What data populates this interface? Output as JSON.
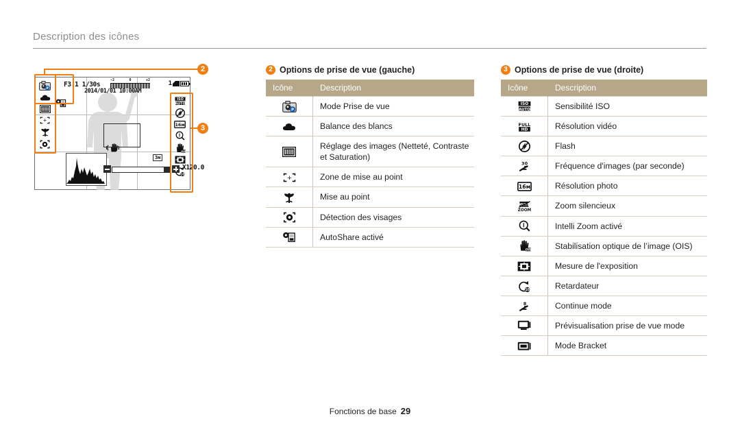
{
  "page": {
    "title": "Description des icônes",
    "footer_label": "Fonctions de base",
    "footer_page": "29"
  },
  "lcd": {
    "aperture_shutter": "F3.1 1/30s",
    "date": "2014/01/01",
    "time": "10:00AM",
    "ev_min": "-2",
    "ev_zero": "0",
    "ev_max": "+2",
    "shots_remaining": "1",
    "zoom_factor": "X120.0",
    "video_res_badge": "3м",
    "left_icons": [
      "shooting-mode-icon",
      "white-balance-icon",
      "image-adjust-icon",
      "focus-area-icon",
      "macro-focus-icon",
      "face-detection-icon"
    ],
    "autoshare_icon": "autoshare-icon",
    "right_icons": [
      "iso-icon",
      "flash-icon",
      "photo-resolution-icon",
      "intelli-zoom-icon",
      "ois-icon",
      "metering-icon",
      "timer-icon"
    ],
    "callout_badges": [
      "2",
      "3"
    ]
  },
  "sections": [
    {
      "badge": "2",
      "title": "Options de prise de vue (gauche)",
      "columns": [
        "Icône",
        "Description"
      ],
      "rows": [
        {
          "icon": "shooting-mode-icon",
          "label": "Mode Prise de vue"
        },
        {
          "icon": "white-balance-icon",
          "label": "Balance des blancs"
        },
        {
          "icon": "image-adjust-icon",
          "label": "Réglage des images (Netteté, Contraste et Saturation)"
        },
        {
          "icon": "focus-area-icon",
          "label": "Zone de mise au point"
        },
        {
          "icon": "macro-focus-icon",
          "label": "Mise au point"
        },
        {
          "icon": "face-detection-icon",
          "label": "Détection des visages"
        },
        {
          "icon": "autoshare-icon",
          "label": "AutoShare activé"
        }
      ]
    },
    {
      "badge": "3",
      "title": "Options de prise de vue (droite)",
      "columns": [
        "Icône",
        "Description"
      ],
      "rows": [
        {
          "icon": "iso-icon",
          "label": "Sensibilité ISO"
        },
        {
          "icon": "video-resolution-icon",
          "label": "Résolution vidéo"
        },
        {
          "icon": "flash-icon",
          "label": "Flash"
        },
        {
          "icon": "frame-rate-icon",
          "label": "Fréquence d'images (par seconde)"
        },
        {
          "icon": "photo-resolution-icon",
          "label": "Résolution photo"
        },
        {
          "icon": "silent-zoom-icon",
          "label": "Zoom silencieux"
        },
        {
          "icon": "intelli-zoom-icon",
          "label": "Intelli Zoom activé"
        },
        {
          "icon": "ois-icon",
          "label": "Stabilisation optique de l’image (OIS)"
        },
        {
          "icon": "metering-icon",
          "label": "Mesure de l'exposition"
        },
        {
          "icon": "timer-icon",
          "label": "Retardateur"
        },
        {
          "icon": "continuous-icon",
          "label": "Continue mode"
        },
        {
          "icon": "shot-preview-icon",
          "label": "Prévisualisation prise de vue mode"
        },
        {
          "icon": "bracket-icon",
          "label": "Mode Bracket"
        }
      ]
    }
  ],
  "colors": {
    "accent_orange": "#f07f13",
    "table_header": "#b5a788",
    "rule": "#9a9a9a",
    "text": "#231f20"
  }
}
